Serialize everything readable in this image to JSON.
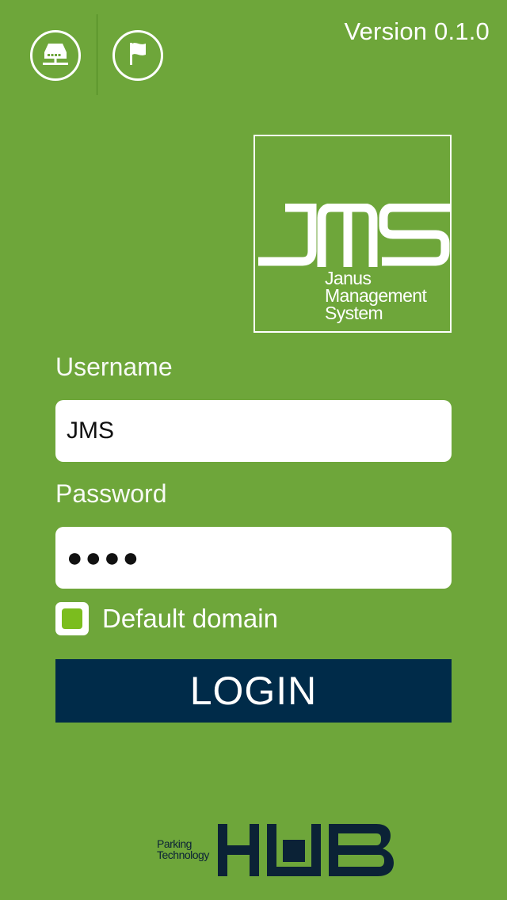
{
  "header": {
    "version": "Version 0.1.0",
    "server_icon": "server-network-icon",
    "flag_icon": "flag-icon"
  },
  "logo": {
    "mark": "JMS",
    "line1": "Janus",
    "line2": "Management",
    "line3": "System"
  },
  "form": {
    "username_label": "Username",
    "username_value": "JMS",
    "password_label": "Password",
    "password_masked": "●●●●",
    "checkbox_label": "Default domain",
    "checkbox_checked": true,
    "login_label": "LOGIN"
  },
  "footer": {
    "small_line1": "Parking",
    "small_line2": "Technology",
    "brand": "HUB"
  },
  "colors": {
    "background": "#6ea63a",
    "login_button": "#002b49",
    "checkbox_accent": "#7bbd1e"
  }
}
